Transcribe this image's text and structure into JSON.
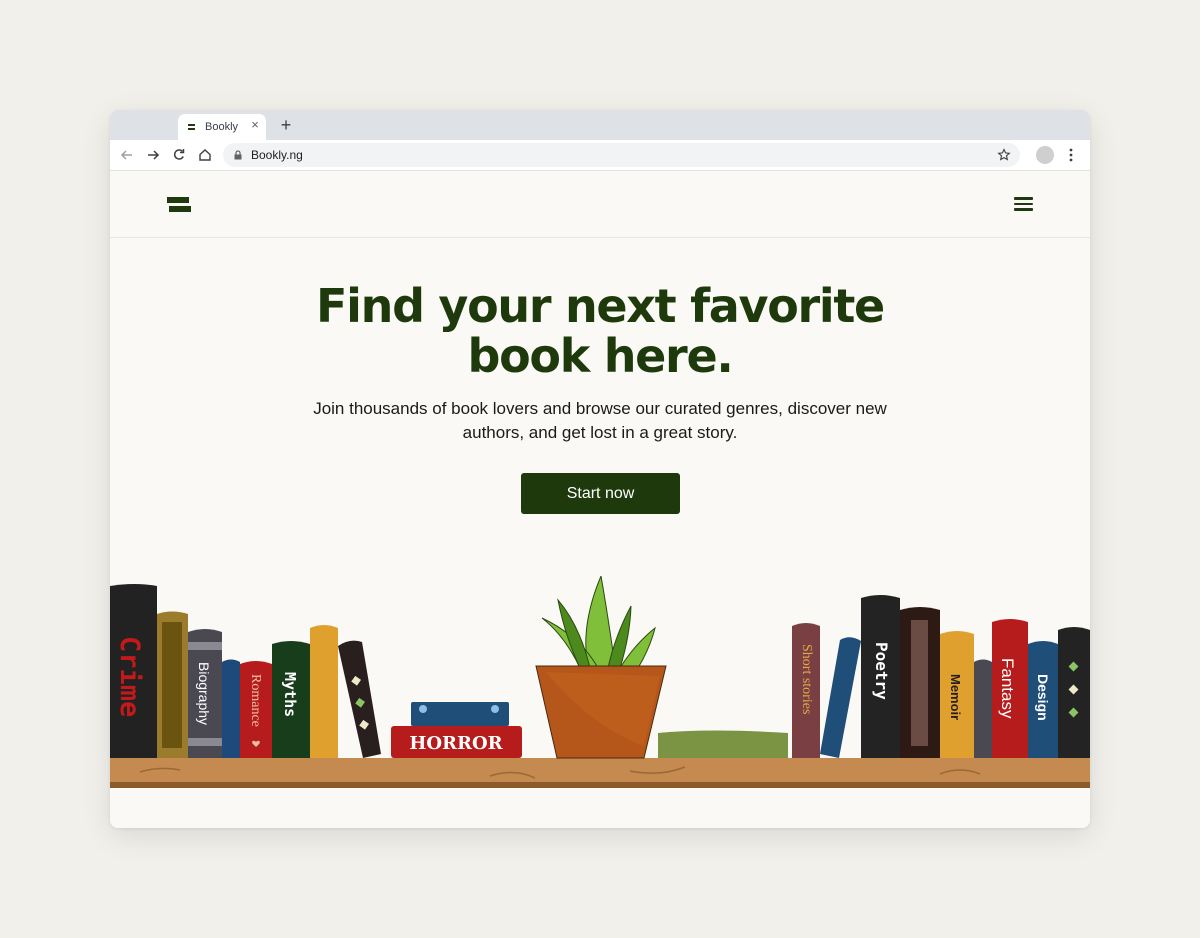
{
  "browser": {
    "tab_title": "Bookly",
    "close_glyph": "×",
    "new_tab_glyph": "+",
    "url": "Bookly.ng"
  },
  "hero": {
    "title": "Find your next favorite book here.",
    "subtitle": "Join thousands of book lovers and browse our curated genres, discover new authors, and get lost in a great story.",
    "cta_label": "Start now"
  },
  "books": {
    "crime": "Crime",
    "biography": "Biography",
    "romance": "Romance",
    "myths": "Myths",
    "horror": "HORROR",
    "short_stories": "Short stories",
    "poetry": "Poetry",
    "memoir": "Memoir",
    "fantasy": "Fantasy",
    "design": "Design"
  },
  "colors": {
    "brand_green": "#1e3a0c",
    "page_bg": "#faf9f5",
    "shelf": "#c48a4f"
  },
  "icons": [
    "back-icon",
    "forward-icon",
    "reload-icon",
    "home-icon",
    "lock-icon",
    "star-icon",
    "menu-icon",
    "hamburger-icon",
    "logo-icon"
  ]
}
